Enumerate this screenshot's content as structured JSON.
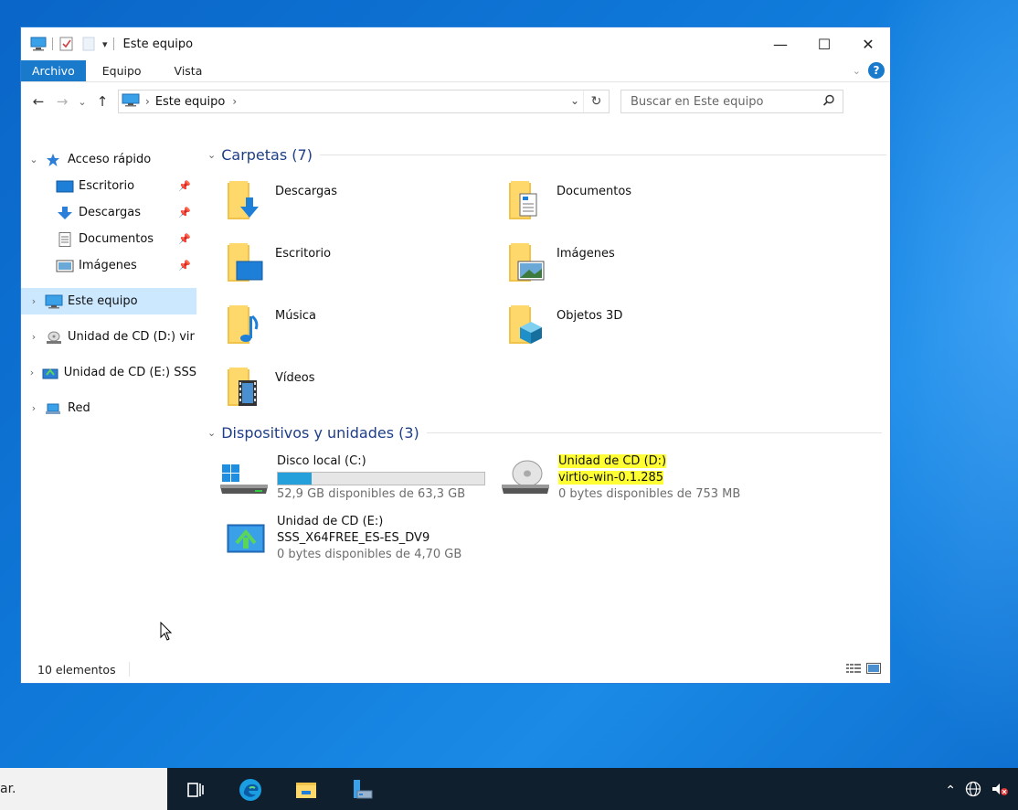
{
  "window": {
    "title": "Este equipo",
    "qat_dropdown": "▾",
    "controls": {
      "minimize": "—",
      "maximize": "☐",
      "close": "✕"
    }
  },
  "ribbon": {
    "tabs": [
      {
        "label": "Archivo",
        "active": true
      },
      {
        "label": "Equipo",
        "active": false
      },
      {
        "label": "Vista",
        "active": false
      }
    ],
    "help": "?"
  },
  "address": {
    "back": "←",
    "forward": "→",
    "recent": "⌄",
    "up": "↑",
    "path": "Este equipo",
    "path_sep": "›",
    "path_trailing_sep": "›",
    "dropdown": "⌄",
    "refresh": "↻",
    "search_placeholder": "Buscar en Este equipo"
  },
  "nav": {
    "quick_access": "Acceso rápido",
    "quick_items": [
      {
        "label": "Escritorio",
        "icon": "desktop-icon"
      },
      {
        "label": "Descargas",
        "icon": "download-icon"
      },
      {
        "label": "Documentos",
        "icon": "document-icon"
      },
      {
        "label": "Imágenes",
        "icon": "pictures-icon"
      }
    ],
    "this_pc": "Este equipo",
    "cd_d": "Unidad de CD (D:) vir",
    "cd_e": "Unidad de CD (E:) SSS",
    "network": "Red"
  },
  "folders_group": {
    "title": "Carpetas (7)"
  },
  "folders": [
    {
      "label": "Descargas",
      "icon": "downloads-folder-icon"
    },
    {
      "label": "Documentos",
      "icon": "documents-folder-icon"
    },
    {
      "label": "Escritorio",
      "icon": "desktop-folder-icon"
    },
    {
      "label": "Imágenes",
      "icon": "pictures-folder-icon"
    },
    {
      "label": "Música",
      "icon": "music-folder-icon"
    },
    {
      "label": "Objetos 3D",
      "icon": "3d-objects-folder-icon"
    },
    {
      "label": "Vídeos",
      "icon": "videos-folder-icon"
    }
  ],
  "devices_group": {
    "title": "Dispositivos y unidades (3)"
  },
  "drives": {
    "c": {
      "name": "Disco local (C:)",
      "free": "52,9 GB disponibles de 63,3 GB",
      "used_fraction": 0.164
    },
    "d": {
      "name": "Unidad de CD (D:)",
      "label": "virtio-win-0.1.285",
      "free": "0 bytes disponibles de 753 MB"
    },
    "e": {
      "name": "Unidad de CD (E:)",
      "label": "SSS_X64FREE_ES-ES_DV9",
      "free": "0 bytes disponibles de 4,70 GB"
    }
  },
  "status": {
    "count": "10 elementos"
  },
  "taskbar": {
    "search_stub": "ar."
  },
  "colors": {
    "accent": "#1979ca",
    "selection": "#cce8ff",
    "highlight": "#ffff33",
    "group_title": "#1e3e87"
  }
}
